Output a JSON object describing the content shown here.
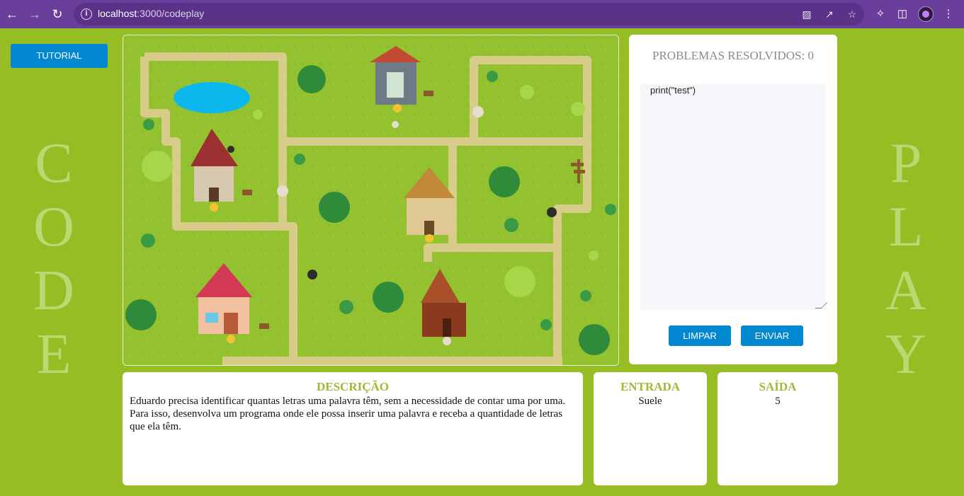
{
  "browser": {
    "url_host": "localhost",
    "url_path": ":3000/codeplay"
  },
  "sidebar": {
    "tutorial_label": "TUTORIAL",
    "left_letters": [
      "C",
      "O",
      "D",
      "E"
    ],
    "right_letters": [
      "P",
      "L",
      "A",
      "Y"
    ]
  },
  "game": {
    "scene": "town-map"
  },
  "editor": {
    "problems_label": "PROBLEMAS RESOLVIDOS: 0",
    "code": "print(\"test\")",
    "clear_label": "LIMPAR",
    "send_label": "ENVIAR"
  },
  "description": {
    "title": "DESCRIÇÃO",
    "text": "Eduardo precisa identificar quantas letras uma palavra têm, sem a necessidade de contar uma por uma. Para isso, desenvolva um programa onde ele possa inserir uma palavra e receba a quantidade de letras que ela têm."
  },
  "input": {
    "title": "ENTRADA",
    "value": "Suele"
  },
  "output": {
    "title": "SAÍDA",
    "value": "5"
  },
  "colors": {
    "background": "#97bd24",
    "accent_button": "#0288d1",
    "chrome": "#6a3f9c",
    "title_green": "#9cbb34"
  }
}
